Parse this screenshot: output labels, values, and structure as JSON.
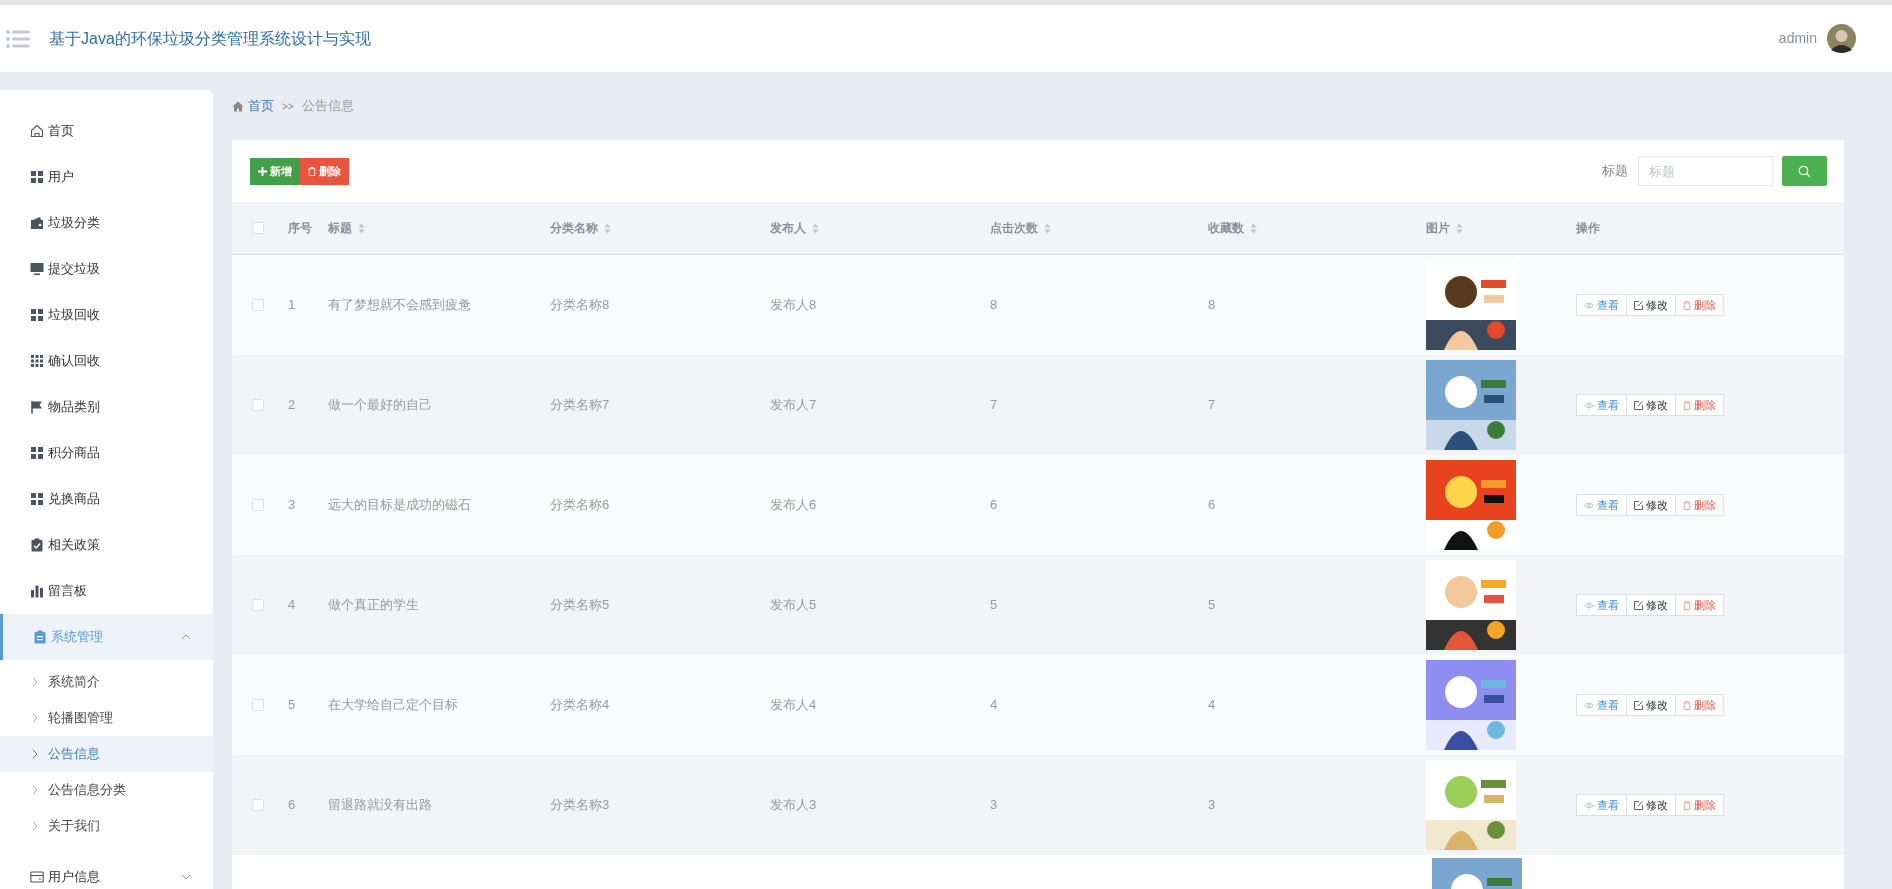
{
  "header": {
    "title": "基于Java的环保垃圾分类管理系统设计与实现",
    "user": "admin"
  },
  "sidebar": {
    "items": [
      {
        "label": "首页",
        "expanded": false
      },
      {
        "label": "用户",
        "expanded": false
      },
      {
        "label": "垃圾分类",
        "expanded": false
      },
      {
        "label": "提交垃圾",
        "expanded": false
      },
      {
        "label": "垃圾回收",
        "expanded": false
      },
      {
        "label": "确认回收",
        "expanded": false
      },
      {
        "label": "物品类别",
        "expanded": false
      },
      {
        "label": "积分商品",
        "expanded": false
      },
      {
        "label": "兑换商品",
        "expanded": false
      },
      {
        "label": "相关政策",
        "expanded": false
      },
      {
        "label": "留言板",
        "expanded": false
      },
      {
        "label": "系统管理",
        "expanded": true,
        "children": [
          {
            "label": "系统简介",
            "selected": false
          },
          {
            "label": "轮播图管理",
            "selected": false
          },
          {
            "label": "公告信息",
            "selected": true
          },
          {
            "label": "公告信息分类",
            "selected": false
          },
          {
            "label": "关于我们",
            "selected": false
          }
        ]
      },
      {
        "label": "用户信息",
        "expanded": false
      }
    ]
  },
  "breadcrumb": [
    "首页",
    "公告信息"
  ],
  "breadcrumb_separator": ">>",
  "toolbar": {
    "add": "新增",
    "delete": "删除",
    "search_label": "标题",
    "search_placeholder": "标题"
  },
  "table": {
    "select_all_checked": false,
    "columns": [
      {
        "label": "序号",
        "sortable": false
      },
      {
        "label": "标题",
        "sortable": true
      },
      {
        "label": "分类名称",
        "sortable": true
      },
      {
        "label": "发布人",
        "sortable": true
      },
      {
        "label": "点击次数",
        "sortable": true
      },
      {
        "label": "收藏数",
        "sortable": true
      },
      {
        "label": "图片",
        "sortable": true
      },
      {
        "label": "操作",
        "sortable": false
      }
    ],
    "rows": [
      {
        "checked": false,
        "index": "1",
        "title": "有了梦想就不会感到疲惫",
        "category": "分类名称8",
        "publisher": "发布人8",
        "clicks": "8",
        "favorites": "8",
        "actions": [
          "查看",
          "修改",
          "删除"
        ]
      },
      {
        "checked": false,
        "index": "2",
        "title": "做一个最好的自己",
        "category": "分类名称7",
        "publisher": "发布人7",
        "clicks": "7",
        "favorites": "7",
        "actions": [
          "查看",
          "修改",
          "删除"
        ]
      },
      {
        "checked": false,
        "index": "3",
        "title": "远大的目标是成功的磁石",
        "category": "分类名称6",
        "publisher": "发布人6",
        "clicks": "6",
        "favorites": "6",
        "actions": [
          "查看",
          "修改",
          "删除"
        ]
      },
      {
        "checked": false,
        "index": "4",
        "title": "做个真正的学生",
        "category": "分类名称5",
        "publisher": "发布人5",
        "clicks": "5",
        "favorites": "5",
        "actions": [
          "查看",
          "修改",
          "删除"
        ]
      },
      {
        "checked": false,
        "index": "5",
        "title": "在大学给自己定个目标",
        "category": "分类名称4",
        "publisher": "发布人4",
        "clicks": "4",
        "favorites": "4",
        "actions": [
          "查看",
          "修改",
          "删除"
        ]
      },
      {
        "checked": false,
        "index": "6",
        "title": "留退路就没有出路",
        "category": "分类名称3",
        "publisher": "发布人3",
        "clicks": "3",
        "favorites": "3",
        "actions": [
          "查看",
          "修改",
          "删除"
        ]
      }
    ]
  }
}
